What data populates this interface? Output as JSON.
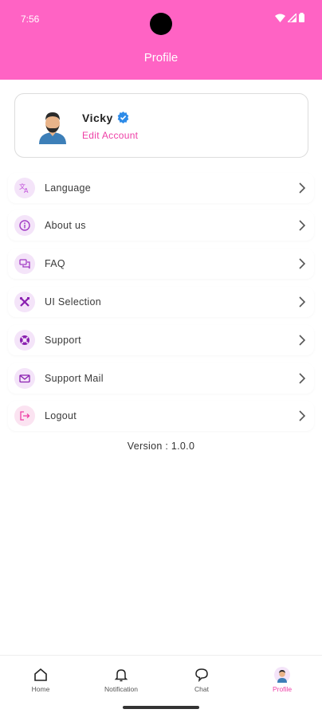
{
  "status_bar": {
    "time": "7:56"
  },
  "header": {
    "title": "Profile",
    "background": "#ff63c4"
  },
  "profile": {
    "name": "Vicky",
    "edit_label": "Edit Account",
    "accent": "#ee3fa6",
    "verified_icon": "verified-badge-icon",
    "avatar_icon": "user-avatar"
  },
  "menu": [
    {
      "label": "Language",
      "icon": "translate-icon"
    },
    {
      "label": "About us",
      "icon": "info-icon"
    },
    {
      "label": "FAQ",
      "icon": "chat-bubbles-icon"
    },
    {
      "label": "UI Selection",
      "icon": "tools-icon"
    },
    {
      "label": "Support",
      "icon": "lifebuoy-icon"
    },
    {
      "label": "Support Mail",
      "icon": "mail-icon"
    },
    {
      "label": "Logout",
      "icon": "logout-icon"
    }
  ],
  "version": "Version : 1.0.0",
  "bottom_nav": [
    {
      "label": "Home",
      "icon": "home-icon",
      "active": false
    },
    {
      "label": "Notification",
      "icon": "bell-icon",
      "active": false
    },
    {
      "label": "Chat",
      "icon": "chat-icon",
      "active": false
    },
    {
      "label": "Profile",
      "icon": "profile-avatar-icon",
      "active": true
    }
  ]
}
